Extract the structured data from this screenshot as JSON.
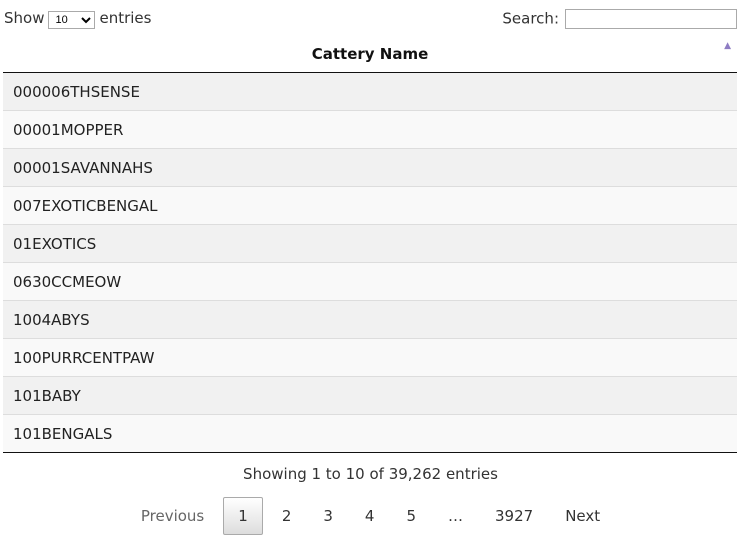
{
  "length": {
    "label_before": "Show",
    "value": "10",
    "label_after": "entries"
  },
  "search": {
    "label": "Search:",
    "value": ""
  },
  "table": {
    "header": "Cattery Name",
    "rows": [
      "000006THSENSE",
      "00001MOPPER",
      "00001SAVANNAHS",
      "007EXOTICBENGAL",
      "01EXOTICS",
      "0630CCMEOW",
      "1004ABYS",
      "100PURRCENTPAW",
      "101BABY",
      "101BENGALS"
    ]
  },
  "info": "Showing 1 to 10 of 39,262 entries",
  "pagination": {
    "previous": "Previous",
    "pages": [
      "1",
      "2",
      "3",
      "4",
      "5",
      "…",
      "3927"
    ],
    "next": "Next",
    "current": "1"
  },
  "colors": {
    "sort_arrow": "#8e7cc3"
  }
}
